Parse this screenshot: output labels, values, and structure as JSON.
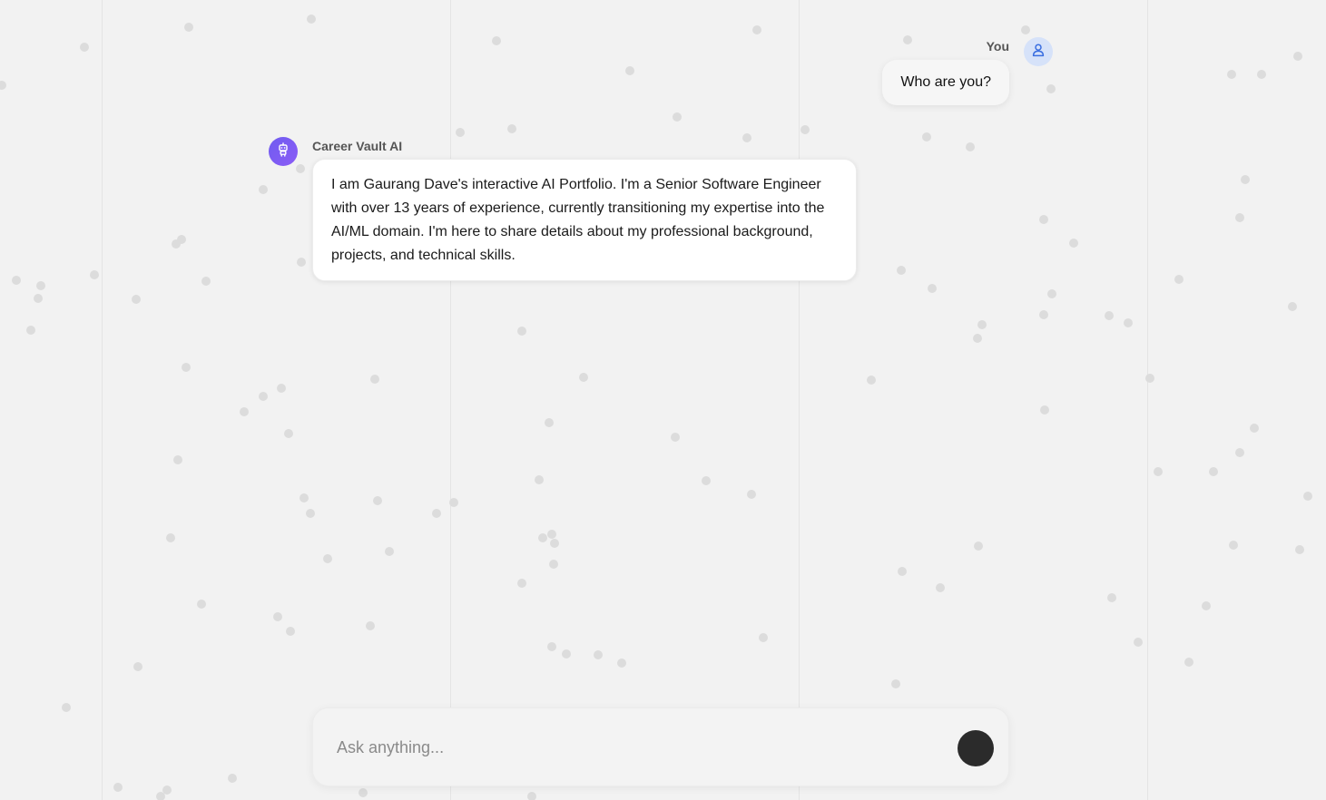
{
  "chat": {
    "messages": [
      {
        "role": "user",
        "sender": "You",
        "text": "Who are you?"
      },
      {
        "role": "assistant",
        "sender": "Career Vault AI",
        "text": "I am Gaurang Dave's interactive AI Portfolio. I'm a Senior Software Engineer with over 13 years of experience, currently transitioning my expertise into the AI/ML domain. I'm here to share details about my professional background, projects, and technical skills."
      }
    ]
  },
  "composer": {
    "placeholder": "Ask anything..."
  },
  "icons": {
    "user_avatar": "user-icon",
    "ai_avatar": "robot-icon"
  },
  "colors": {
    "background": "#f2f2f2",
    "ai_avatar": "#7c5cf2",
    "user_avatar_bg": "#d6e2f9",
    "user_avatar_icon": "#3b6fe0",
    "send_button": "#2b2b2b"
  }
}
